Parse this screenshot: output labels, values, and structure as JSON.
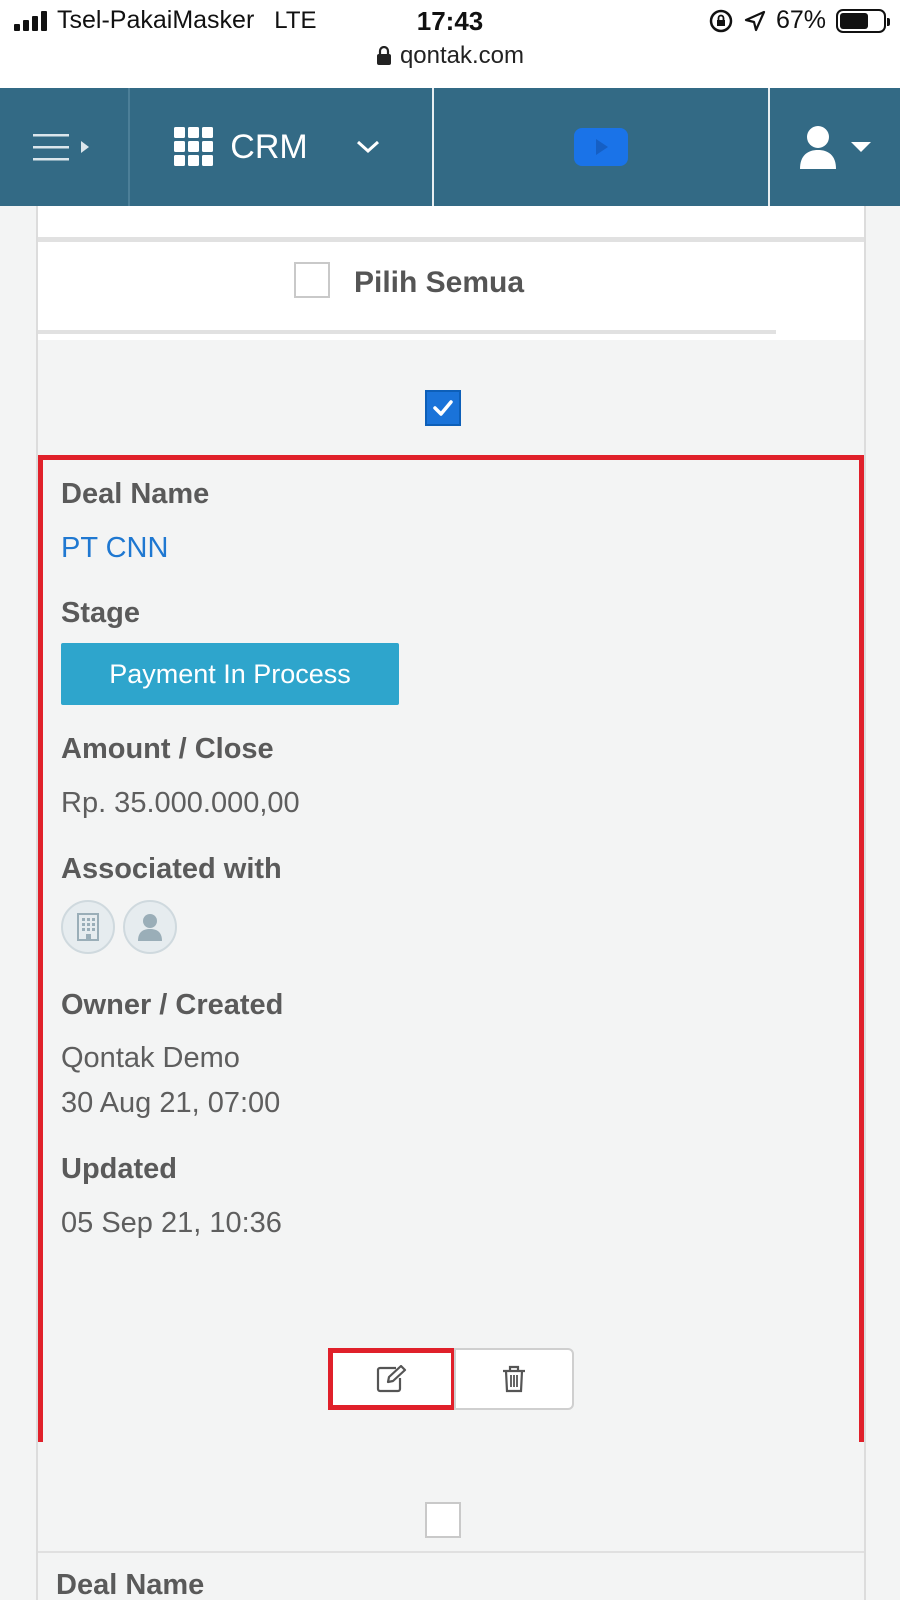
{
  "status_bar": {
    "carrier": "Tsel-PakaiMasker",
    "network": "LTE",
    "time": "17:43",
    "battery": "67%",
    "battery_level": 0.67,
    "url": "qontak.com"
  },
  "header": {
    "app_name": "CRM",
    "colors": {
      "bar": "#336a85",
      "video": "#1a73e8"
    }
  },
  "list": {
    "select_all_label": "Pilih Semua",
    "select_all_checked": false
  },
  "deal": {
    "checked": true,
    "deal_name_label": "Deal Name",
    "deal_name": "PT CNN",
    "stage_label": "Stage",
    "stage": "Payment In Process",
    "amount_label": "Amount / Close",
    "amount": "Rp. 35.000.000,00",
    "associated_label": "Associated with",
    "associated_icons": [
      "building-icon",
      "person-icon"
    ],
    "owner_label": "Owner / Created",
    "owner": "Qontak Demo",
    "created": "30 Aug 21, 07:00",
    "updated_label": "Updated",
    "updated": "05 Sep 21, 10:36",
    "actions": [
      "edit-icon",
      "trash-icon"
    ]
  },
  "next_deal": {
    "checked": false,
    "deal_name_label": "Deal Name"
  }
}
